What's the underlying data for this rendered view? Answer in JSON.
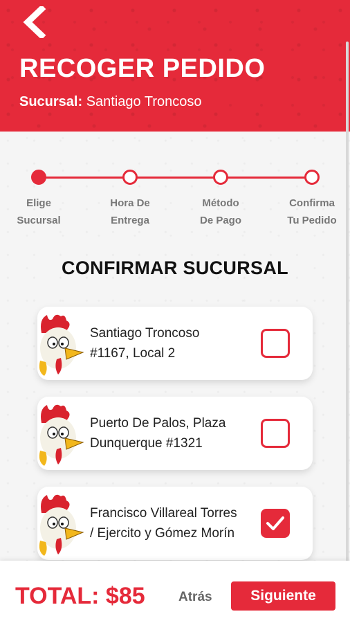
{
  "header": {
    "title": "RECOGER PEDIDO",
    "branch_label": "Sucursal:",
    "branch_value": "Santiago Troncoso",
    "back_icon": "chevron-left-icon"
  },
  "steps": [
    {
      "label_line1": "Elige",
      "label_line2": "Sucursal",
      "active": true
    },
    {
      "label_line1": "Hora De",
      "label_line2": "Entrega",
      "active": false
    },
    {
      "label_line1": "Método",
      "label_line2": "De Pago",
      "active": false
    },
    {
      "label_line1": "Confirma",
      "label_line2": "Tu Pedido",
      "active": false
    }
  ],
  "section_title": "CONFIRMAR SUCURSAL",
  "branches": [
    {
      "name": "Santiago Troncoso #1167, Local 2",
      "checked": false
    },
    {
      "name": "Puerto De Palos, Plaza Dunquerque #1321",
      "checked": false
    },
    {
      "name": "Francisco Villareal Torres / Ejercito y Gómez Morín",
      "checked": true
    }
  ],
  "footer": {
    "total": "TOTAL: $85",
    "back_label": "Atrás",
    "next_label": "Siguiente"
  },
  "colors": {
    "accent": "#e52a3a",
    "muted_text": "#777777"
  }
}
